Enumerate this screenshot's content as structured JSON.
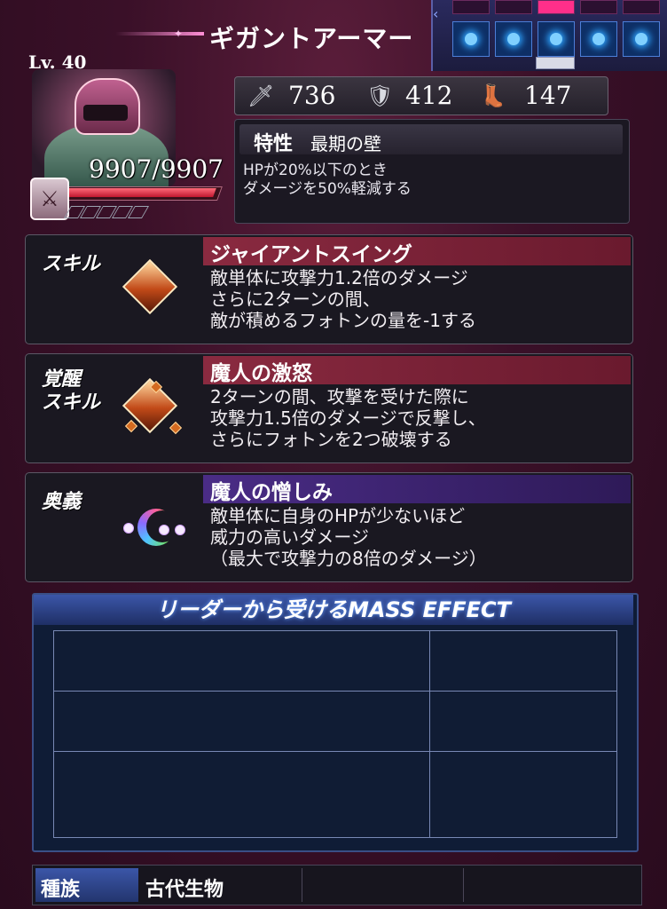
{
  "header": {
    "unit_name": "ギガントアーマー",
    "phase_orbs_active": 5
  },
  "unit": {
    "level": "Lv. 40",
    "hp_text": "9907/9907",
    "hp_fraction": 1.0
  },
  "stats": {
    "attack": "736",
    "defense": "412",
    "speed": "147",
    "attack_icon": "sword-icon",
    "defense_icon": "shield-icon",
    "speed_icon": "boot-icon"
  },
  "trait": {
    "label": "特性",
    "name": "最期の壁",
    "description": "HPが20%以下のとき\nダメージを50%軽減する"
  },
  "skills": [
    {
      "label": "スキル",
      "name": "ジャイアントスイング",
      "description": "敵単体に攻撃力1.2倍のダメージ\nさらに2ターンの間、\n敵が積めるフォトンの量を-1する",
      "header_color": "#7a2036"
    },
    {
      "label": "覚醒\nスキル",
      "name": "魔人の激怒",
      "description": "2ターンの間、攻撃を受けた際に\n攻撃力1.5倍のダメージで反撃し、\nさらにフォトンを2つ破壊する",
      "header_color": "#7a2036"
    },
    {
      "label": "奥義",
      "name": "魔人の憎しみ",
      "description": "敵単体に自身のHPが少ないほど\n威力の高いダメージ\n（最大で攻撃力の8倍のダメージ）",
      "header_color": "#3f2670"
    }
  ],
  "mass_effect": {
    "title": "リーダーから受けるMASS EFFECT"
  },
  "race": {
    "label": "種族",
    "value": "古代生物"
  }
}
